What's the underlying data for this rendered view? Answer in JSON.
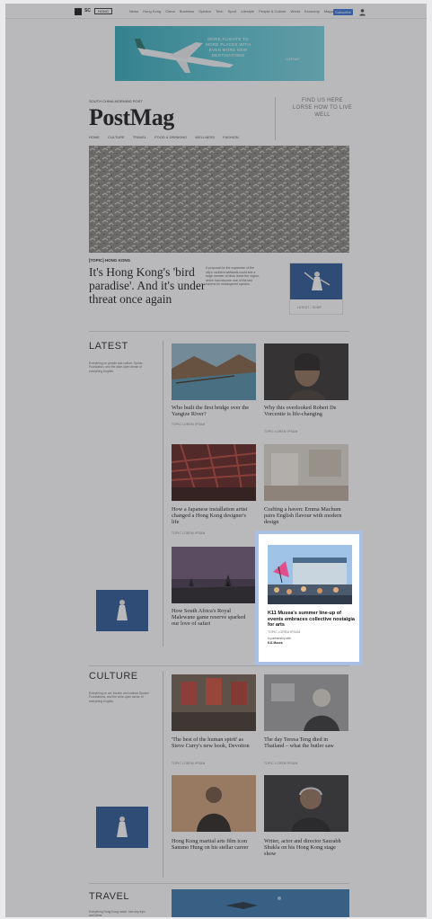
{
  "topbar": {
    "logo_text": "SC",
    "edition": "HONG",
    "nav": [
      "News",
      "Hong Kong",
      "China",
      "Business",
      "Opinion",
      "Tech",
      "Sport",
      "Lifestyle",
      "People & Culture",
      "World",
      "Economy",
      "Magazine",
      "More"
    ],
    "subscribe": "Subscribe",
    "user_icon": "user-icon"
  },
  "ad": {
    "text": "MORE FLIGHTS TO MORE PLACES WITH EVEN MORE NEW DESTINATIONS",
    "brand": "CATHAY"
  },
  "masthead": {
    "publisher": "SOUTH CHINA MORNING POST",
    "title": "PostMag",
    "nav": [
      "HOME",
      "CULTURE",
      "TRAVEL",
      "FOOD & DRINKING",
      "WELLNESS",
      "FASHION"
    ],
    "promo": "FIND US HERE\nLORSE HOW TO LIVE\nWELL"
  },
  "hero": {
    "kicker": "[TOPIC] HONG KONG",
    "title": "It's Hong Kong's 'bird paradise'. And it's under threat once again",
    "summary": "A proposal for the expansion of the city's northern wetlands could see a large number of birds leave the region, which has become one of the last havens for endangered species",
    "side_caption": "LATEST / SCMP"
  },
  "latest": {
    "heading": "LATEST",
    "blurb": "Everything on people and culture: Sports Foundation, and the wide-open sense of everything English.",
    "cards": [
      {
        "title": "Who built the first bridge over the Yangtze River?",
        "meta": "TOPIC LOREM IPSUM"
      },
      {
        "title": "Why this overlooked Robert De Vorcentie is life-changing",
        "meta": "TOPIC LOREM IPSUM"
      },
      {
        "title": "How a Japanese installation artist changed a Hong Kong designer's life",
        "meta": "TOPIC LOREM IPSUM"
      },
      {
        "title": "Crafting a haven: Emma Machum pairs English flavour with modern design",
        "meta": "TOPIC LOREM IPSUM"
      },
      {
        "title": "How South Africa's Royal Malewane game reserve sparked our love of safari",
        "meta": "TOPIC LOREM IPSUM"
      }
    ]
  },
  "highlight": {
    "title": "K11 Musea's summer line-up of events embraces collective nostalgia for arts",
    "meta": "TOPIC LOREM IPSUM",
    "partner_label": "In partnership with",
    "partner": "K11 Musea"
  },
  "culture": {
    "heading": "CULTURE",
    "blurb": "Everything on art, theatre and cultural Spoken Foundations, and the wide-open sense of everything English.",
    "cards": [
      {
        "title": "'The best of the human spirit' as Steve Curry's new book, Devotion",
        "meta": "TOPIC LOREM IPSUM"
      },
      {
        "title": "The day Teresa Teng died in Thailand – what the butler saw",
        "meta": "TOPIC LOREM IPSUM"
      },
      {
        "title": "Hong Kong martial arts film icon Sammo Hung on his stellar career",
        "meta": "TOPIC LOREM IPSUM"
      },
      {
        "title": "Writer, actor and director Saurabh Shukla on his Hong Kong stage show",
        "meta": "TOPIC LOREM IPSUM"
      }
    ]
  },
  "travel": {
    "heading": "TRAVEL",
    "blurb": "Everything Hong Kong travel: free day trips and ideas."
  },
  "colors": {
    "highlight_border": "#a9bfe4",
    "subscribe_bg": "#2f6fd6",
    "ad_bg": "#3fb5c5"
  }
}
